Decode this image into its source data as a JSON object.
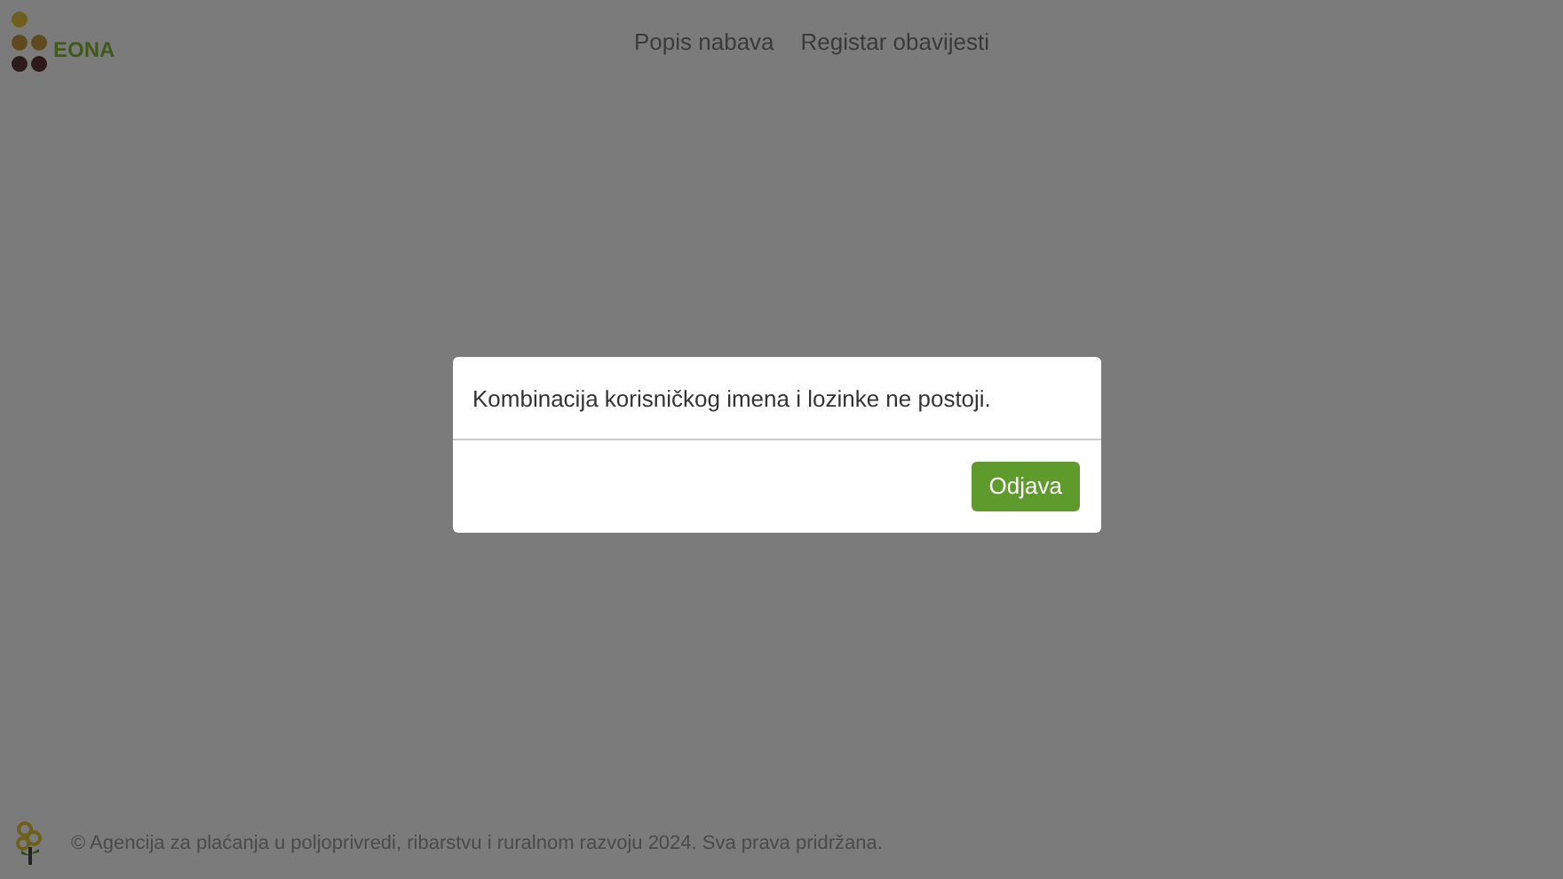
{
  "header": {
    "logo_text": "EONA",
    "nav": [
      {
        "label": "Popis nabava"
      },
      {
        "label": "Registar obavijesti"
      }
    ]
  },
  "dialog": {
    "message": "Kombinacija korisničkog imena i lozinke ne postoji.",
    "buttons": [
      {
        "label": "Odjava"
      }
    ]
  },
  "footer": {
    "text": "© Agencija za plaćanja u poljoprivredi, ribarstvu i ruralnom razvoju 2024. Sva prava pridržana."
  }
}
